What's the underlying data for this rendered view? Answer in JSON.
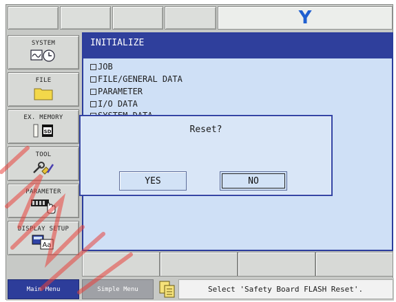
{
  "top_bar": {
    "right_tab_letter": "Y"
  },
  "side_menu": {
    "items": [
      {
        "label": "SYSTEM"
      },
      {
        "label": "FILE"
      },
      {
        "label": "EX. MEMORY"
      },
      {
        "label": "TOOL"
      },
      {
        "label": "PARAMETER"
      },
      {
        "label": "DISPLAY SETUP"
      }
    ],
    "sd_label": "SD",
    "display_icon_text": "Aa"
  },
  "main": {
    "title": "INITIALIZE",
    "items": [
      "JOB",
      "FILE/GENERAL DATA",
      "PARAMETER",
      "I/O DATA",
      "SYSTEM DATA"
    ]
  },
  "dialog": {
    "message": "Reset?",
    "yes_label": "YES",
    "no_label": "NO"
  },
  "status_bar": {
    "main_menu_label": "Main Menu",
    "simple_menu_label": "Simple Menu",
    "message": "Select 'Safety Board FLASH Reset'."
  },
  "colors": {
    "accent_blue": "#2f3f9c",
    "panel_background": "#cfe0f6",
    "y_letter": "#1f5fd0"
  }
}
